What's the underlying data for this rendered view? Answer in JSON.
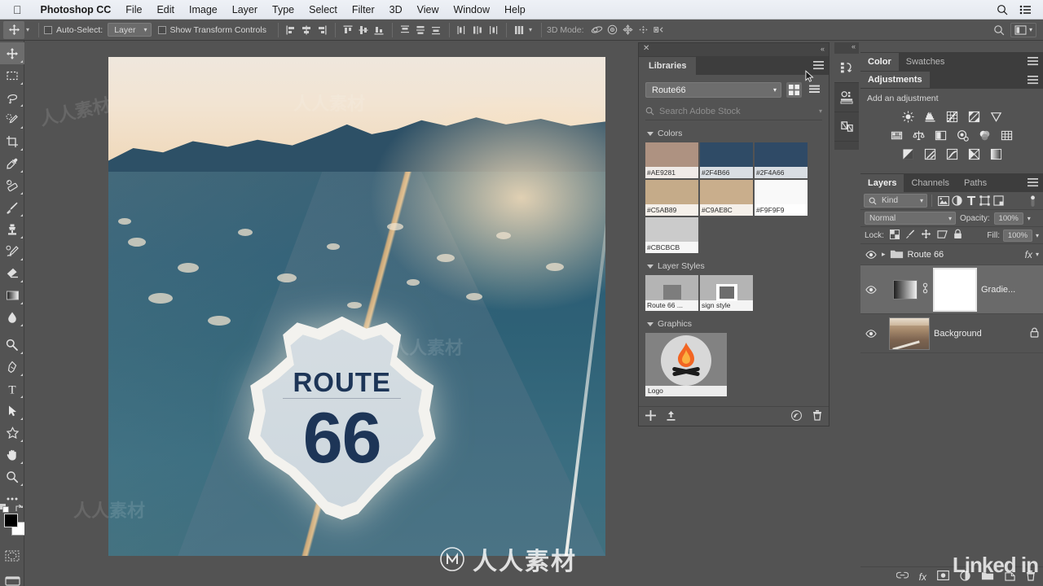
{
  "app": {
    "name": "Photoshop CC"
  },
  "macbar": {
    "apple_icon": "apple-icon",
    "menus": [
      "Photoshop CC",
      "File",
      "Edit",
      "Image",
      "Layer",
      "Type",
      "Select",
      "Filter",
      "3D",
      "View",
      "Window",
      "Help"
    ],
    "right_icons": [
      "search-icon",
      "control-center-icon"
    ]
  },
  "options_bar": {
    "tool_icon": "move-tool-icon",
    "auto_select_label": "Auto-Select:",
    "auto_select_value": "Layer",
    "show_transform_label": "Show Transform Controls",
    "align_icons": [
      "align-left-edges-icon",
      "align-horizontal-centers-icon",
      "align-right-edges-icon",
      "align-top-edges-icon",
      "align-vertical-centers-icon",
      "align-bottom-edges-icon"
    ],
    "distribute_icons": [
      "distribute-top-edges-icon",
      "distribute-vertical-centers-icon",
      "distribute-bottom-edges-icon",
      "distribute-left-edges-icon",
      "distribute-horizontal-centers-icon",
      "distribute-right-edges-icon"
    ],
    "extra_icon": "distribute-spacing-icon",
    "mode_3d_label": "3D Mode:",
    "mode_3d_icons": [
      "orbit-3d-icon",
      "roll-3d-icon",
      "pan-3d-icon",
      "slide-3d-icon",
      "scale-3d-icon"
    ],
    "right": {
      "search_icon": "search-icon",
      "workspace_icon": "workspace-switcher-icon",
      "chevron": "chevron-down-icon"
    }
  },
  "toolbar": {
    "tools": [
      {
        "name": "move-tool",
        "active": true,
        "flyout": true
      },
      {
        "name": "rectangular-marquee-tool",
        "active": false,
        "flyout": true
      },
      {
        "name": "lasso-tool",
        "active": false,
        "flyout": true
      },
      {
        "name": "quick-selection-tool",
        "active": false,
        "flyout": true
      },
      {
        "name": "crop-tool",
        "active": false,
        "flyout": true
      },
      {
        "name": "eyedropper-tool",
        "active": false,
        "flyout": true
      },
      {
        "name": "spot-healing-brush-tool",
        "active": false,
        "flyout": true
      },
      {
        "name": "brush-tool",
        "active": false,
        "flyout": true
      },
      {
        "name": "clone-stamp-tool",
        "active": false,
        "flyout": true
      },
      {
        "name": "history-brush-tool",
        "active": false,
        "flyout": true
      },
      {
        "name": "eraser-tool",
        "active": false,
        "flyout": true
      },
      {
        "name": "gradient-tool",
        "active": false,
        "flyout": true
      },
      {
        "name": "blur-tool",
        "active": false,
        "flyout": true
      },
      {
        "name": "dodge-tool",
        "active": false,
        "flyout": true
      },
      {
        "name": "pen-tool",
        "active": false,
        "flyout": true
      },
      {
        "name": "type-tool",
        "active": false,
        "flyout": true
      },
      {
        "name": "path-selection-tool",
        "active": false,
        "flyout": true
      },
      {
        "name": "custom-shape-tool",
        "active": false,
        "flyout": true
      },
      {
        "name": "hand-tool",
        "active": false,
        "flyout": true
      },
      {
        "name": "zoom-tool",
        "active": false,
        "flyout": true
      },
      {
        "name": "edit-toolbar-tool",
        "active": false,
        "flyout": true
      }
    ],
    "foreground_color": "#000000",
    "background_color": "#ffffff",
    "quick_mask_icon": "quick-mask-icon",
    "screen_mode_icon": "screen-mode-icon"
  },
  "canvas": {
    "shield": {
      "top_text": "ROUTE",
      "number": "66"
    },
    "watermarks": [
      "人人素材",
      "Linked in"
    ]
  },
  "libraries": {
    "close_icon": "close-icon",
    "collapse_icon": "collapse-panel-icon",
    "tab_label": "Libraries",
    "menu_icon": "panel-menu-icon",
    "selected_library": "Route66",
    "view_grid_icon": "grid-view-icon",
    "view_list_icon": "list-view-icon",
    "search_placeholder": "Search Adobe Stock",
    "search_icon": "search-icon",
    "search_chevron": "chevron-down-icon",
    "sections": {
      "colors_label": "Colors",
      "colors": [
        "#AE9281",
        "#2F4B66",
        "#2F4A66",
        "#C5AB89",
        "#C9AE8C",
        "#F9F9F9",
        "#CBCBCB"
      ],
      "layer_styles_label": "Layer Styles",
      "layer_styles": [
        "Route 66 ...",
        "sign style"
      ],
      "graphics_label": "Graphics",
      "graphics": [
        "Logo"
      ]
    },
    "footer_icons": [
      "add-item-icon",
      "upload-icon",
      "creative-cloud-icon",
      "delete-icon"
    ]
  },
  "icon_dock": {
    "collapse_icon": "collapse-dock-icon",
    "items": [
      "history-icon",
      "properties-icon",
      "layer-comps-icon"
    ]
  },
  "color_panel": {
    "tabs": [
      {
        "label": "Color",
        "active": true
      },
      {
        "label": "Swatches",
        "active": false
      }
    ],
    "menu_icon": "panel-menu-icon"
  },
  "adjustments_panel": {
    "title": "Adjustments",
    "menu_icon": "panel-menu-icon",
    "subtitle": "Add an adjustment",
    "row1": [
      "brightness-contrast-icon",
      "levels-icon",
      "curves-icon",
      "exposure-icon",
      "vibrance-icon"
    ],
    "row2": [
      "hue-saturation-icon",
      "color-balance-icon",
      "black-white-icon",
      "photo-filter-icon",
      "channel-mixer-icon",
      "color-lookup-icon"
    ],
    "row3": [
      "invert-icon",
      "posterize-icon",
      "threshold-icon",
      "selective-color-icon",
      "gradient-map-icon"
    ]
  },
  "layers_panel": {
    "tabs": [
      {
        "label": "Layers",
        "active": true
      },
      {
        "label": "Channels",
        "active": false
      },
      {
        "label": "Paths",
        "active": false
      }
    ],
    "menu_icon": "panel-menu-icon",
    "filter_label": "Kind",
    "filter_icon": "search-icon",
    "filter_chevron": "chevron-down-icon",
    "filter_types": [
      "pixel-filter-icon",
      "adjustment-filter-icon",
      "type-filter-icon",
      "shape-filter-icon",
      "smart-object-filter-icon"
    ],
    "filter_toggle": "filter-toggle-icon",
    "blend_mode": "Normal",
    "opacity_label": "Opacity:",
    "opacity_value": "100%",
    "lock_label": "Lock:",
    "lock_icons": [
      "lock-transparency-icon",
      "lock-image-icon",
      "lock-position-icon",
      "lock-artboard-icon",
      "lock-all-icon"
    ],
    "fill_label": "Fill:",
    "fill_value": "100%",
    "layers": [
      {
        "name": "Route 66",
        "type": "group",
        "visible": true,
        "selected": false,
        "has_fx": true,
        "expand_icon": "chevron-right-icon",
        "thumb": "folder-icon"
      },
      {
        "name": "Gradie...",
        "type": "gradient-fill",
        "visible": true,
        "selected": true,
        "has_mask": true,
        "link_icon": "link-icon"
      },
      {
        "name": "Background",
        "type": "image",
        "visible": true,
        "selected": false,
        "locked": true,
        "lock_icon": "lock-icon"
      }
    ],
    "footer_icons": [
      "link-layers-icon",
      "add-fx-icon",
      "add-mask-icon",
      "new-adjustment-icon",
      "new-group-icon",
      "new-layer-icon",
      "delete-layer-icon"
    ]
  }
}
